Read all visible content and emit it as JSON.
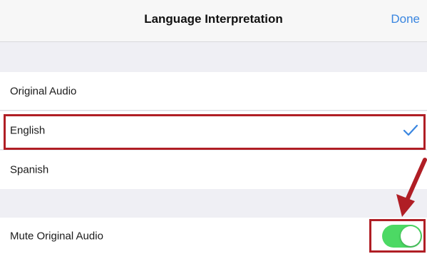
{
  "navbar": {
    "title": "Language Interpretation",
    "done_label": "Done"
  },
  "options": [
    {
      "label": "Original Audio",
      "selected": false
    },
    {
      "label": "English",
      "selected": true
    },
    {
      "label": "Spanish",
      "selected": false
    }
  ],
  "mute": {
    "label": "Mute Original Audio",
    "enabled": true
  },
  "colors": {
    "accent": "#3a86e0",
    "toggle_on": "#4cd964",
    "annotation": "#b01e25"
  },
  "icons": {
    "selected": "checkmark-icon",
    "annotation": "arrow-icon"
  }
}
